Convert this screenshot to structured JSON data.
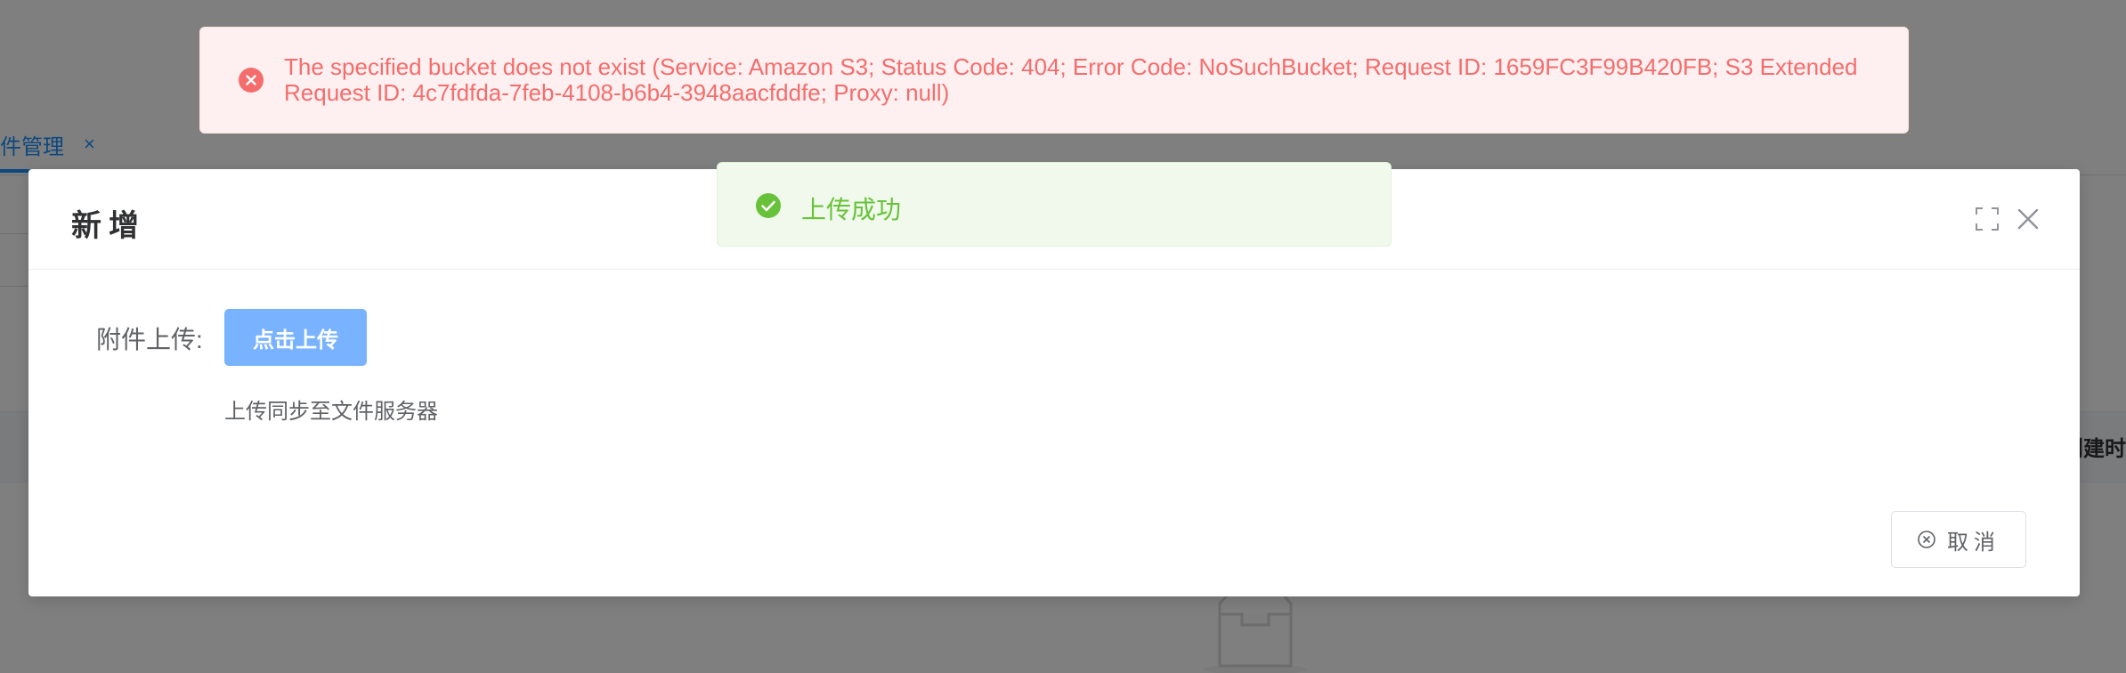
{
  "background": {
    "tab_label": "件管理",
    "tab_close": "×",
    "table_col_label": "创建时"
  },
  "error_message": {
    "text": "The specified bucket does not exist (Service: Amazon S3; Status Code: 404; Error Code: NoSuchBucket; Request ID: 1659FC3F99B420FB; S3 Extended Request ID: 4c7fdfda-7feb-4108-b6b4-3948aacfddfe; Proxy: null)",
    "icon": "error-circle-icon",
    "color": "#f56c6c"
  },
  "success_message": {
    "text": "上传成功",
    "icon": "check-circle-icon",
    "color": "#67c23a"
  },
  "dialog": {
    "title": "新增",
    "form": {
      "label": "附件上传:",
      "upload_button": "点击上传",
      "hint": "上传同步至文件服务器"
    },
    "footer": {
      "cancel_label": "取消"
    }
  },
  "colors": {
    "primary": "#1890ff",
    "upload_button": "#79b3ff"
  }
}
